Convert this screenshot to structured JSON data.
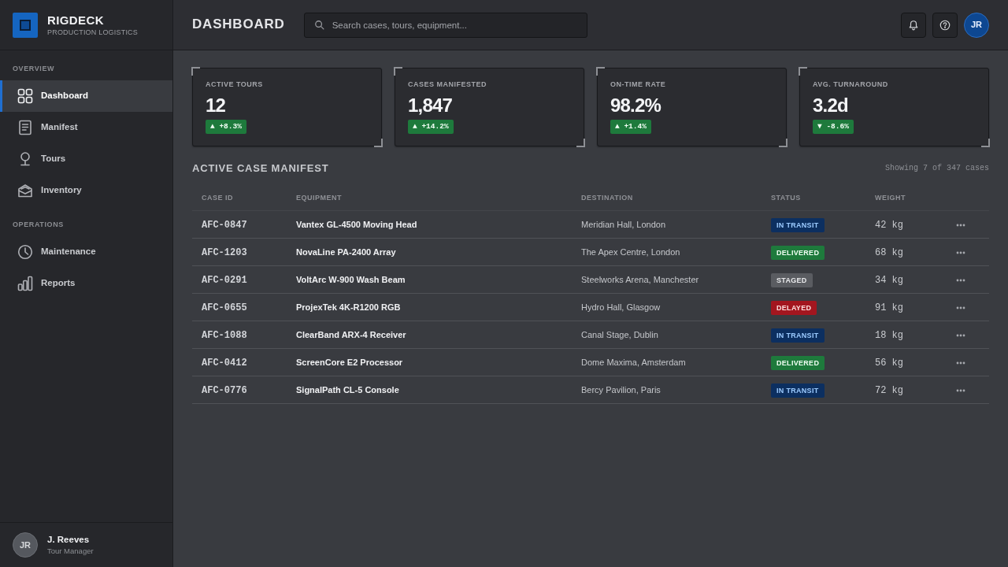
{
  "brand": {
    "name": "RIGDECK",
    "tagline": "PRODUCTION LOGISTICS"
  },
  "sidebar": {
    "sections": [
      {
        "title": "OVERVIEW",
        "items": [
          {
            "label": "Dashboard",
            "selected": true
          },
          {
            "label": "Manifest",
            "selected": false
          },
          {
            "label": "Tours",
            "selected": false
          },
          {
            "label": "Inventory",
            "selected": false
          }
        ]
      },
      {
        "title": "OPERATIONS",
        "items": [
          {
            "label": "Maintenance",
            "selected": false
          },
          {
            "label": "Reports",
            "selected": false
          }
        ]
      }
    ]
  },
  "user": {
    "initials": "JR",
    "name": "J. Reeves",
    "role": "Tour Manager"
  },
  "header": {
    "title": "DASHBOARD",
    "search": {
      "placeholder": "Search cases, tours, equipment..."
    },
    "avatar": "JR"
  },
  "stats": [
    {
      "label": "ACTIVE TOURS",
      "value": "12",
      "delta": "▲ +8.3%"
    },
    {
      "label": "CASES MANIFESTED",
      "value": "1,847",
      "delta": "▲ +14.2%"
    },
    {
      "label": "ON-TIME RATE",
      "value": "98.2%",
      "delta": "▲ +1.4%"
    },
    {
      "label": "AVG. TURNAROUND",
      "value": "3.2d",
      "delta": "▼ -8.6%"
    }
  ],
  "manifest": {
    "title": "ACTIVE CASE MANIFEST",
    "summary": "Showing 7 of 347 cases",
    "columns": [
      "CASE ID",
      "EQUIPMENT",
      "DESTINATION",
      "STATUS",
      "WEIGHT"
    ],
    "rows": [
      {
        "case_id": "AFC-0847",
        "equipment": "Vantex GL-4500 Moving Head",
        "destination": "Meridian Hall, London",
        "status": {
          "label": "IN TRANSIT",
          "kind": "transit"
        },
        "weight": "42 kg"
      },
      {
        "case_id": "AFC-1203",
        "equipment": "NovaLine PA-2400 Array",
        "destination": "The Apex Centre, London",
        "status": {
          "label": "DELIVERED",
          "kind": "delivered"
        },
        "weight": "68 kg"
      },
      {
        "case_id": "AFC-0291",
        "equipment": "VoltArc W-900 Wash Beam",
        "destination": "Steelworks Arena, Manchester",
        "status": {
          "label": "STAGED",
          "kind": "staged"
        },
        "weight": "34 kg"
      },
      {
        "case_id": "AFC-0655",
        "equipment": "ProjexTek 4K-R1200 RGB",
        "destination": "Hydro Hall, Glasgow",
        "status": {
          "label": "DELAYED",
          "kind": "delayed"
        },
        "weight": "91 kg"
      },
      {
        "case_id": "AFC-1088",
        "equipment": "ClearBand ARX-4 Receiver",
        "destination": "Canal Stage, Dublin",
        "status": {
          "label": "IN TRANSIT",
          "kind": "transit"
        },
        "weight": "18 kg"
      },
      {
        "case_id": "AFC-0412",
        "equipment": "ScreenCore E2 Processor",
        "destination": "Dome Maxima, Amsterdam",
        "status": {
          "label": "DELIVERED",
          "kind": "delivered"
        },
        "weight": "56 kg"
      },
      {
        "case_id": "AFC-0776",
        "equipment": "SignalPath CL-5 Console",
        "destination": "Bercy Pavilion, Paris",
        "status": {
          "label": "IN TRANSIT",
          "kind": "transit"
        },
        "weight": "72 kg"
      }
    ]
  }
}
